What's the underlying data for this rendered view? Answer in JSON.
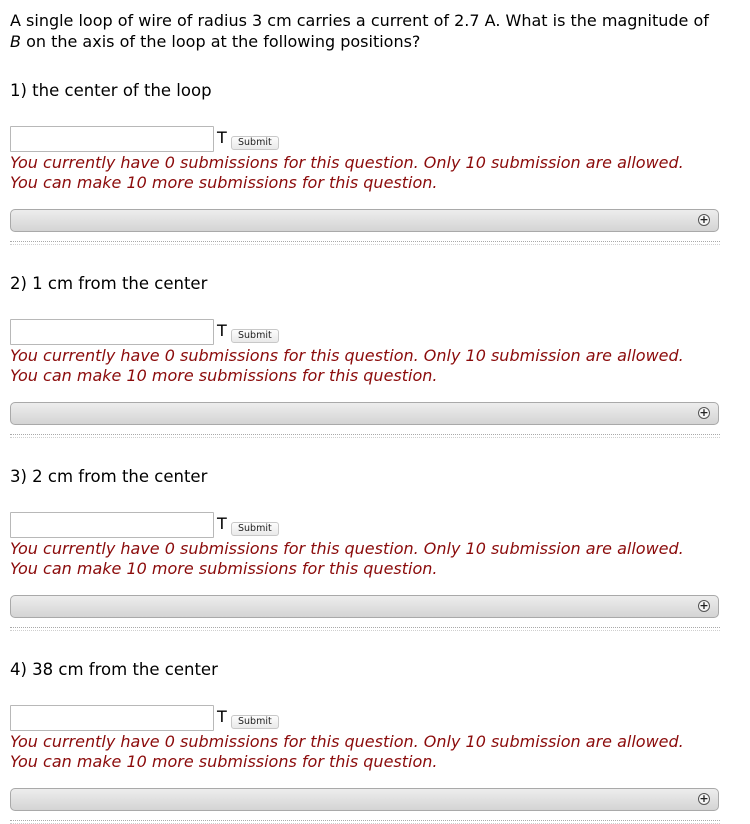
{
  "problem": {
    "intro_line1": "A single loop of wire of radius 3 cm carries a current of 2.7 A. What is the magnitude of",
    "intro_var": "B",
    "intro_line2": " on the axis of the loop at the following positions?"
  },
  "questions": [
    {
      "label": "1) the center of the loop",
      "answer_value": "",
      "unit": "T",
      "submit_label": "Submit",
      "message1": "You currently have 0 submissions for this question. Only 10 submission are allowed.",
      "message2": "You can make 10 more submissions for this question.",
      "expand_icon": "plus-circle-icon"
    },
    {
      "label": "2) 1 cm from the center",
      "answer_value": "",
      "unit": "T",
      "submit_label": "Submit",
      "message1": "You currently have 0 submissions for this question. Only 10 submission are allowed.",
      "message2": "You can make 10 more submissions for this question.",
      "expand_icon": "plus-circle-icon"
    },
    {
      "label": "3) 2 cm from the center",
      "answer_value": "",
      "unit": "T",
      "submit_label": "Submit",
      "message1": "You currently have 0 submissions for this question. Only 10 submission are allowed.",
      "message2": "You can make 10 more submissions for this question.",
      "expand_icon": "plus-circle-icon"
    },
    {
      "label": "4) 38 cm from the center",
      "answer_value": "",
      "unit": "T",
      "submit_label": "Submit",
      "message1": "You currently have 0 submissions for this question. Only 10 submission are allowed.",
      "message2": "You can make 10 more submissions for this question.",
      "expand_icon": "plus-circle-icon"
    }
  ],
  "colors": {
    "message": "#8b0b0b",
    "bar_border": "#a9a9a9"
  }
}
